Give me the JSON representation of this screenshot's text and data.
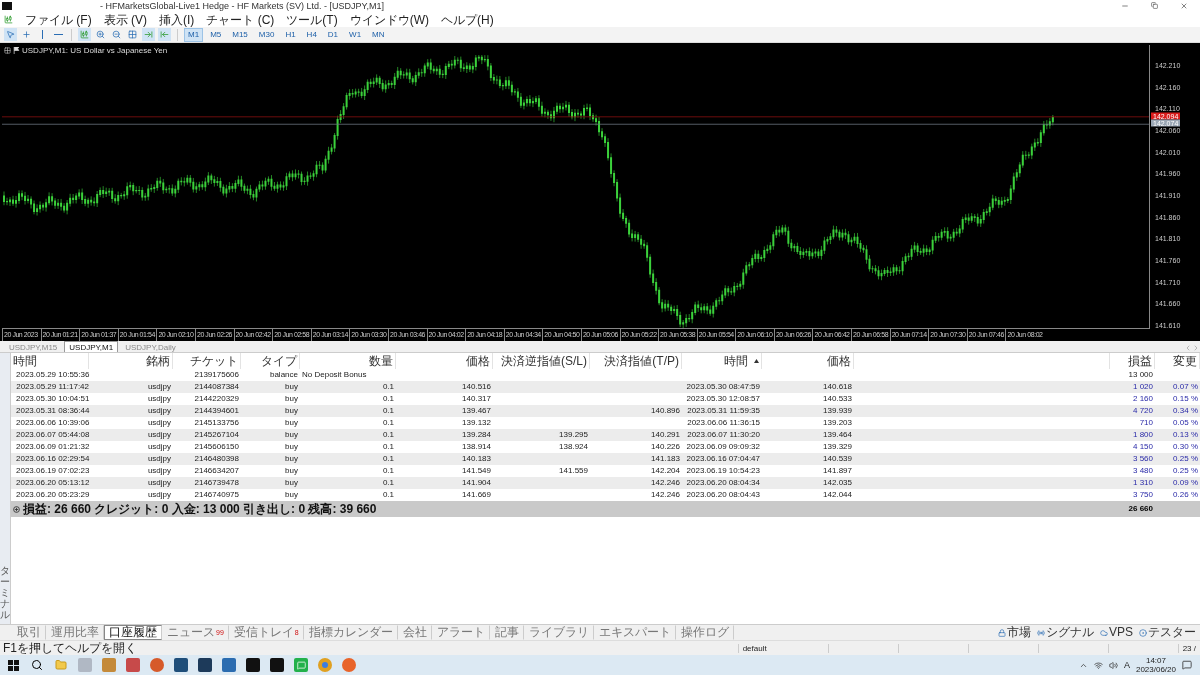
{
  "window": {
    "title": "- HFMarketsGlobal-Live1 Hedge - HF Markets (SV) Ltd. - [USDJPY,M1]"
  },
  "menu": [
    "ファイル (F)",
    "表示 (V)",
    "挿入(I)",
    "チャート (C)",
    "ツール(T)",
    "ウインドウ(W)",
    "ヘルプ(H)"
  ],
  "toolbar": {
    "periods": [
      {
        "label": "M1",
        "selected": true
      },
      {
        "label": "M5",
        "selected": false
      },
      {
        "label": "M15",
        "selected": false
      },
      {
        "label": "M30",
        "selected": false
      },
      {
        "label": "H1",
        "selected": false
      },
      {
        "label": "H4",
        "selected": false
      },
      {
        "label": "D1",
        "selected": false
      },
      {
        "label": "W1",
        "selected": false
      },
      {
        "label": "MN",
        "selected": false
      }
    ]
  },
  "chart": {
    "title": "USDJPY,M1:  US Dollar vs Japanese Yen",
    "price_labels": [
      "142.210",
      "142.160",
      "142.110",
      "142.060",
      "142.010",
      "141.960",
      "141.910",
      "141.860",
      "141.810",
      "141.760",
      "141.710",
      "141.660",
      "141.610"
    ],
    "price_tags": [
      {
        "text": "142.094",
        "color": "#d91b1b"
      },
      {
        "text": "142.074",
        "color": "#9aa6b4"
      }
    ],
    "time_labels": [
      "20 Jun 2023",
      "20 Jun 01:21",
      "20 Jun 01:37",
      "20 Jun 01:54",
      "20 Jun 02:10",
      "20 Jun 02:26",
      "20 Jun 02:42",
      "20 Jun 02:58",
      "20 Jun 03:14",
      "20 Jun 03:30",
      "20 Jun 03:46",
      "20 Jun 04:02",
      "20 Jun 04:18",
      "20 Jun 04:34",
      "20 Jun 04:50",
      "20 Jun 05:06",
      "20 Jun 05:22",
      "20 Jun 05:38",
      "20 Jun 05:54",
      "20 Jun 06:10",
      "20 Jun 06:26",
      "20 Jun 06:42",
      "20 Jun 06:58",
      "20 Jun 07:14",
      "20 Jun 07:30",
      "20 Jun 07:46",
      "20 Jun 08:02"
    ]
  },
  "chart_tabs": [
    {
      "label": "USDJPY,M15",
      "selected": false
    },
    {
      "label": "USDJPY,M1",
      "selected": true
    },
    {
      "label": "USDJPY,Daily",
      "selected": false
    }
  ],
  "terminal": {
    "side_label": "ターミナル",
    "columns": [
      {
        "label": "時間",
        "sorted": false
      },
      {
        "label": "銘柄",
        "sorted": false
      },
      {
        "label": "チケット",
        "sorted": false
      },
      {
        "label": "タイプ",
        "sorted": false
      },
      {
        "label": "数量",
        "sorted": false
      },
      {
        "label": "価格",
        "sorted": false
      },
      {
        "label": "決済逆指値(S/L)",
        "sorted": false
      },
      {
        "label": "決済指値(T/P)",
        "sorted": false
      },
      {
        "label": "時間",
        "sorted": true
      },
      {
        "label": "価格",
        "sorted": false
      },
      {
        "label": "損益",
        "sorted": false
      },
      {
        "label": "変更",
        "sorted": false
      }
    ],
    "rows": [
      {
        "kind": "balance",
        "time": "2023.05.29 10:55:36",
        "ticket": "2139175606",
        "type": "balance",
        "comment": "No Deposit Bonus",
        "profit": "13 000"
      },
      {
        "kind": "trade",
        "time": "2023.05.29 11:17:42",
        "symbol": "usdjpy",
        "ticket": "2144087384",
        "type": "buy",
        "size": "0.1",
        "price": "140.516",
        "close_time": "2023.05.30 08:47:59",
        "close_price": "140.618",
        "profit": "1 020",
        "change": "0.07 %"
      },
      {
        "kind": "trade",
        "time": "2023.05.30 10:04:51",
        "symbol": "usdjpy",
        "ticket": "2144220329",
        "type": "buy",
        "size": "0.1",
        "price": "140.317",
        "close_time": "2023.05.30 12:08:57",
        "close_price": "140.533",
        "profit": "2 160",
        "change": "0.15 %"
      },
      {
        "kind": "trade",
        "time": "2023.05.31 08:36:44",
        "symbol": "usdjpy",
        "ticket": "2144394601",
        "type": "buy",
        "size": "0.1",
        "price": "139.467",
        "tp": "140.896",
        "close_time": "2023.05.31 11:59:35",
        "close_price": "139.939",
        "profit": "4 720",
        "change": "0.34 %"
      },
      {
        "kind": "trade",
        "time": "2023.06.06 10:39:06",
        "symbol": "usdjpy",
        "ticket": "2145133756",
        "type": "buy",
        "size": "0.1",
        "price": "139.132",
        "close_time": "2023.06.06 11:36:15",
        "close_price": "139.203",
        "profit": "710",
        "change": "0.05 %"
      },
      {
        "kind": "trade",
        "time": "2023.06.07 05:44:08",
        "symbol": "usdjpy",
        "ticket": "2145267104",
        "type": "buy",
        "size": "0.1",
        "price": "139.284",
        "sl": "139.295",
        "tp": "140.291",
        "close_time": "2023.06.07 11:30:20",
        "close_price": "139.464",
        "profit": "1 800",
        "change": "0.13 %"
      },
      {
        "kind": "trade",
        "time": "2023.06.09 01:21:32",
        "symbol": "usdjpy",
        "ticket": "2145606150",
        "type": "buy",
        "size": "0.1",
        "price": "138.914",
        "sl": "138.924",
        "tp": "140.226",
        "close_time": "2023.06.09 09:09:32",
        "close_price": "139.329",
        "profit": "4 150",
        "change": "0.30 %"
      },
      {
        "kind": "trade",
        "time": "2023.06.16 02:29:54",
        "symbol": "usdjpy",
        "ticket": "2146480398",
        "type": "buy",
        "size": "0.1",
        "price": "140.183",
        "tp": "141.183",
        "close_time": "2023.06.16 07:04:47",
        "close_price": "140.539",
        "profit": "3 560",
        "change": "0.25 %"
      },
      {
        "kind": "trade",
        "time": "2023.06.19 07:02:23",
        "symbol": "usdjpy",
        "ticket": "2146634207",
        "type": "buy",
        "size": "0.1",
        "price": "141.549",
        "sl": "141.559",
        "tp": "142.204",
        "close_time": "2023.06.19 10:54:23",
        "close_price": "141.897",
        "profit": "3 480",
        "change": "0.25 %"
      },
      {
        "kind": "trade",
        "time": "2023.06.20 05:13:12",
        "symbol": "usdjpy",
        "ticket": "2146739478",
        "type": "buy",
        "size": "0.1",
        "price": "141.904",
        "tp": "142.246",
        "close_time": "2023.06.20 08:04:34",
        "close_price": "142.035",
        "profit": "1 310",
        "change": "0.09 %"
      },
      {
        "kind": "trade",
        "time": "2023.06.20 05:23:29",
        "symbol": "usdjpy",
        "ticket": "2146740975",
        "type": "buy",
        "size": "0.1",
        "price": "141.669",
        "tp": "142.246",
        "close_time": "2023.06.20 08:04:43",
        "close_price": "142.044",
        "profit": "3 750",
        "change": "0.26 %"
      }
    ],
    "summary": {
      "text": "損益: 26 660  クレジット: 0  入金: 13 000  引き出し: 0  残高: 39 660",
      "profit": "26 660"
    },
    "tabs": [
      {
        "label": "取引",
        "selected": false
      },
      {
        "label": "運用比率",
        "selected": false
      },
      {
        "label": "口座履歴",
        "selected": true
      },
      {
        "label": "ニュース",
        "badge": "99",
        "selected": false
      },
      {
        "label": "受信トレイ",
        "badge": "8",
        "selected": false
      },
      {
        "label": "指標カレンダー",
        "selected": false
      },
      {
        "label": "会社",
        "selected": false
      },
      {
        "label": "アラート",
        "selected": false
      },
      {
        "label": "記事",
        "selected": false
      },
      {
        "label": "ライブラリ",
        "selected": false
      },
      {
        "label": "エキスパート",
        "selected": false
      },
      {
        "label": "操作ログ",
        "selected": false
      }
    ],
    "right_tabs": [
      "市場",
      "シグナル",
      "VPS",
      "テスター"
    ]
  },
  "status_bar": {
    "help": "F1を押してヘルプを開く",
    "profile": "default",
    "connection": "23 /"
  },
  "taskbar": {
    "ime": "A",
    "time": "14:07",
    "date": "2023/06/20"
  }
}
